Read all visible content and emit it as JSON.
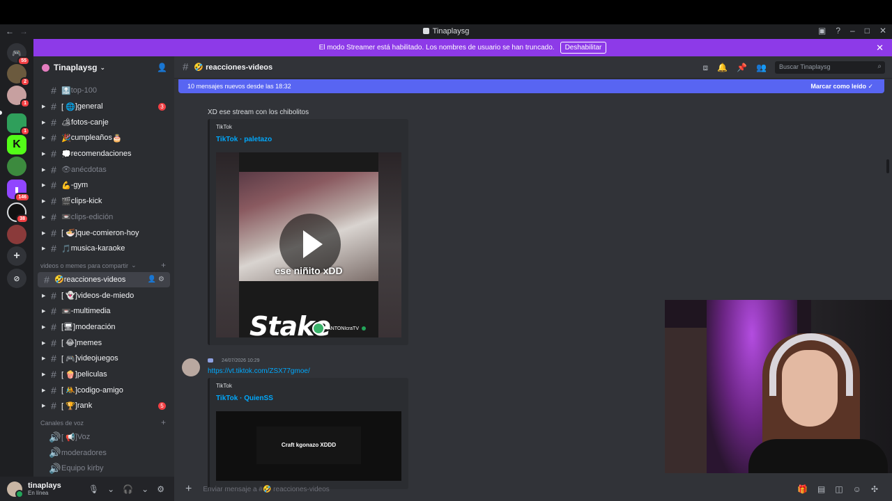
{
  "window": {
    "title": "Tinaplaysg"
  },
  "banner": {
    "text": "El modo Streamer está habilitado. Los nombres de usuario se han truncado.",
    "button": "Deshabilitar"
  },
  "servers": [
    {
      "badge": "55"
    },
    {
      "badge": "2"
    },
    {
      "badge": "1"
    },
    {
      "badge": "1"
    },
    {
      "badge": ""
    },
    {
      "badge": ""
    },
    {
      "badge": "146"
    },
    {
      "badge": "38"
    },
    {
      "badge": ""
    }
  ],
  "guild": {
    "name": "Tinaplaysg"
  },
  "channels": [
    {
      "name": "top-100",
      "emoji": "🔝",
      "muted": true
    },
    {
      "name": "]general",
      "prefix": "[ 🌐 ",
      "badge": "3"
    },
    {
      "name": "fotos-canje",
      "emoji": "🏕"
    },
    {
      "name": "cumpleaños",
      "emoji": "🎉",
      "suffix": " 🎂"
    },
    {
      "name": "recomendaciones",
      "emoji": "💭"
    },
    {
      "name": "anécdotas",
      "emoji": "👁",
      "muted": true
    },
    {
      "name": "-gym",
      "emoji": "💪"
    },
    {
      "name": "clips-kick",
      "emoji": "🎬"
    },
    {
      "name": "clips-edición",
      "emoji": "📼",
      "muted": true
    },
    {
      "name": "]que-comieron-hoy",
      "prefix": "[ 🍜 "
    },
    {
      "name": "musica-karaoke",
      "emoji": "🎵"
    }
  ],
  "category1": {
    "name": "videos o memes para compartir"
  },
  "channels2": [
    {
      "name": "reacciones-videos",
      "emoji": "🤣",
      "active": true
    },
    {
      "name": "]videos-de-miedo",
      "prefix": "[ 👻 "
    },
    {
      "name": "-multimedia",
      "emoji": "📼"
    },
    {
      "name": "[🖥]moderación",
      "prefix": ""
    },
    {
      "name": "]memes",
      "prefix": "[ 😂 "
    },
    {
      "name": "]videojuegos",
      "prefix": "[ 🎮 "
    },
    {
      "name": "]peliculas",
      "prefix": "[ 🍿 "
    },
    {
      "name": "]codigo-amigo",
      "prefix": "[ 🤼 "
    },
    {
      "name": "]rank",
      "prefix": "[ 🏆 ",
      "badge": "5"
    }
  ],
  "category2": {
    "name": "Canales de voz"
  },
  "voice": [
    {
      "name": "]Voz",
      "prefix": "[ 📢 "
    },
    {
      "name": "moderadores"
    },
    {
      "name": "Equipo kirby"
    }
  ],
  "user": {
    "name": "tinaplays",
    "status": "En línea"
  },
  "header": {
    "channel": "🤣 reacciones-videos",
    "search_placeholder": "Buscar Tinaplaysg"
  },
  "newbar": {
    "text": "10 mensajes nuevos desde las 18:32",
    "mark": "Marcar como leído"
  },
  "messages": {
    "m1_text": "XD ese stream con los chibolitos",
    "embed1_provider": "TikTok",
    "embed1_title": "TikTok · paletazo",
    "video1_caption": "ese niñito xDD",
    "video1_brand": "Stake",
    "video1_user": "ANTONIcraTV",
    "m2_time": "24/07/2026 10:29",
    "m2_link": "https://vt.tiktok.com/ZSX77gmoe/",
    "embed2_provider": "TikTok",
    "embed2_title": "TikTok · QuienSS",
    "video2_caption": "Craft kgonazo XDDD"
  },
  "composer": {
    "placeholder": "Enviar mensaje a #🤣 reacciones-videos"
  },
  "colors": {
    "accent": "#5865f2",
    "streamer_banner": "#8d3ae8",
    "link": "#00a8fc"
  }
}
